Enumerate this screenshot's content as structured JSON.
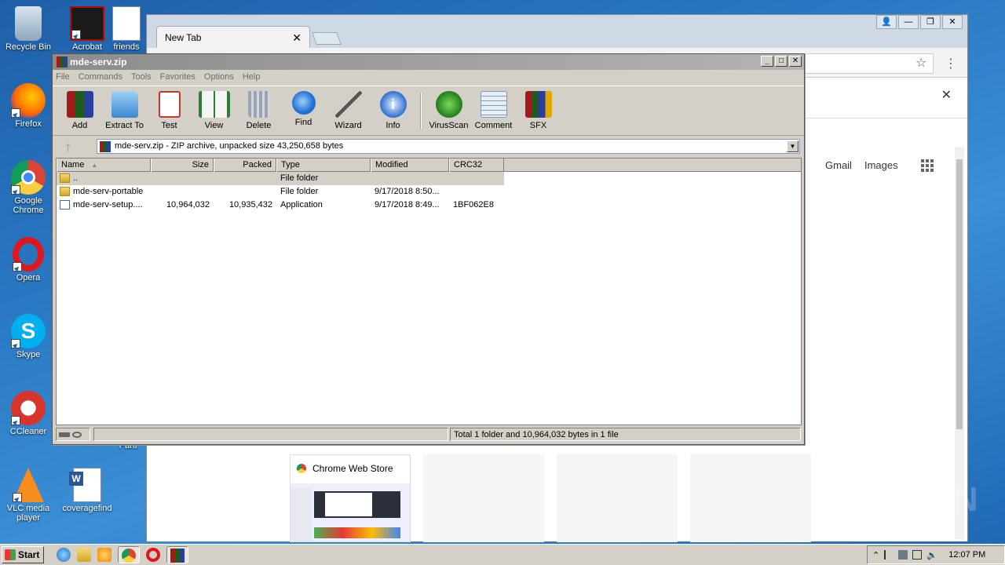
{
  "desktop": {
    "icons": [
      {
        "label": "Recycle Bin"
      },
      {
        "label": "Acrobat"
      },
      {
        "label": "Firefox"
      },
      {
        "label": "Google Chrome"
      },
      {
        "label": "Opera"
      },
      {
        "label": "Skype"
      },
      {
        "label": "CCleaner"
      },
      {
        "label": "VLC media player"
      },
      {
        "label": "coveragefind"
      },
      {
        "label": "friends"
      }
    ],
    "partial_label": "Parti"
  },
  "chrome": {
    "tab_title": "New Tab",
    "links": [
      "Gmail",
      "Images"
    ],
    "tiles": [
      {
        "title": "Chrome Web Store"
      }
    ],
    "colors": {
      "tabstrip": "#cfd9e6"
    }
  },
  "winrar": {
    "title": "mde-serv.zip",
    "menu": [
      "File",
      "Commands",
      "Tools",
      "Favorites",
      "Options",
      "Help"
    ],
    "toolbar": [
      {
        "label": "Add",
        "icon": "add-archive-icon"
      },
      {
        "label": "Extract To",
        "icon": "extract-folder-icon"
      },
      {
        "label": "Test",
        "icon": "test-clipboard-icon"
      },
      {
        "label": "View",
        "icon": "view-book-icon"
      },
      {
        "label": "Delete",
        "icon": "trash-icon"
      },
      {
        "label": "Find",
        "icon": "magnifier-icon"
      },
      {
        "label": "Wizard",
        "icon": "magic-wand-icon"
      },
      {
        "label": "Info",
        "icon": "info-icon"
      },
      {
        "label": "VirusScan",
        "icon": "virus-scan-icon"
      },
      {
        "label": "Comment",
        "icon": "comment-icon"
      },
      {
        "label": "SFX",
        "icon": "sfx-books-icon"
      }
    ],
    "path": "mde-serv.zip - ZIP archive, unpacked size 43,250,658 bytes",
    "columns": [
      "Name",
      "Size",
      "Packed",
      "Type",
      "Modified",
      "CRC32"
    ],
    "rows": [
      {
        "name": "..",
        "size": "",
        "packed": "",
        "type": "File folder",
        "modified": "",
        "crc": "",
        "kind": "folder"
      },
      {
        "name": "mde-serv-portable",
        "size": "",
        "packed": "",
        "type": "File folder",
        "modified": "9/17/2018 8:50...",
        "crc": "",
        "kind": "folder"
      },
      {
        "name": "mde-serv-setup....",
        "size": "10,964,032",
        "packed": "10,935,432",
        "type": "Application",
        "modified": "9/17/2018 8:49...",
        "crc": "1BF062E8",
        "kind": "app"
      }
    ],
    "status": "Total 1 folder and 10,964,032 bytes in 1 file"
  },
  "taskbar": {
    "start_label": "Start",
    "clock": "12:07 PM"
  },
  "watermark": "ANY RUN"
}
